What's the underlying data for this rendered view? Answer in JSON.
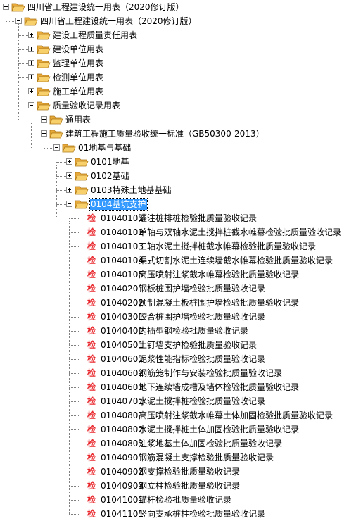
{
  "tree": {
    "root": "四川省工程建设统一用表（2020修订版）",
    "book": "四川省工程建设统一用表（2020修订版）",
    "sections": [
      "建设工程质量责任用表",
      "建设单位用表",
      "监理单位用表",
      "检测单位用表",
      "施工单位用表"
    ],
    "quality": "质量验收记录用表",
    "general": "通用表",
    "standard": "建筑工程施工质量验收统一标准（GB50300-2013）",
    "foundation": "01地基与基础",
    "sub": [
      "0101地基",
      "0102基础",
      "0103特殊土地基基础"
    ],
    "selected": "0104基坑支护",
    "check_icon": "检",
    "records": [
      {
        "code": "01040101",
        "name": "灌注桩排桩检验批质量验收记录"
      },
      {
        "code": "01040102",
        "name": "单轴与双轴水泥土搅拌桩截水帷幕检验批质量验收记录"
      },
      {
        "code": "01040103",
        "name": "三轴水泥土搅拌桩截水帷幕检验批质量验收记录"
      },
      {
        "code": "01040104",
        "name": "渠式切割水泥土连续墙截水帷幕检验批质量验收记录"
      },
      {
        "code": "01040105",
        "name": "高压喷射注浆截水帷幕检验批质量验收记录"
      },
      {
        "code": "01040201",
        "name": "钢板桩围护墙检验批质量验收记录"
      },
      {
        "code": "01040202",
        "name": "预制混凝土板桩围护墙检验批质量验收记录"
      },
      {
        "code": "01040301",
        "name": "咬合桩围护墙检验批质量验收记录"
      },
      {
        "code": "01040401",
        "name": "内插型钢检验批质量验收记录"
      },
      {
        "code": "01040501",
        "name": "土钉墙支护检验批质量验收记录"
      },
      {
        "code": "01040601",
        "name": "泥浆性能指标检验批质量验收记录"
      },
      {
        "code": "01040602",
        "name": "钢筋笼制作与安装检验批质量验收记录"
      },
      {
        "code": "01040603",
        "name": "地下连续墙成槽及墙体检验批质量验收记录"
      },
      {
        "code": "01040701",
        "name": "水泥土搅拌桩检验批质量验收记录"
      },
      {
        "code": "01040801",
        "name": "高压喷射注浆截水帷幕土体加固检验批质量验收记录"
      },
      {
        "code": "01040802",
        "name": "水泥土搅拌桩土体加固检验批质量验收记录"
      },
      {
        "code": "01040803",
        "name": "注浆地基土体加固检验批质量验收记录"
      },
      {
        "code": "01040901",
        "name": "钢筋混凝土支撑检验批质量验收记录"
      },
      {
        "code": "01040902",
        "name": "钢支撑检验批质量验收记录"
      },
      {
        "code": "01040903",
        "name": "钢立柱检验批质量验收记录"
      },
      {
        "code": "01041001",
        "name": "锚杆检验批质量验收记录"
      },
      {
        "code": "01041101",
        "name": "竖向支承桩柱检验批质量验收记录"
      }
    ]
  }
}
